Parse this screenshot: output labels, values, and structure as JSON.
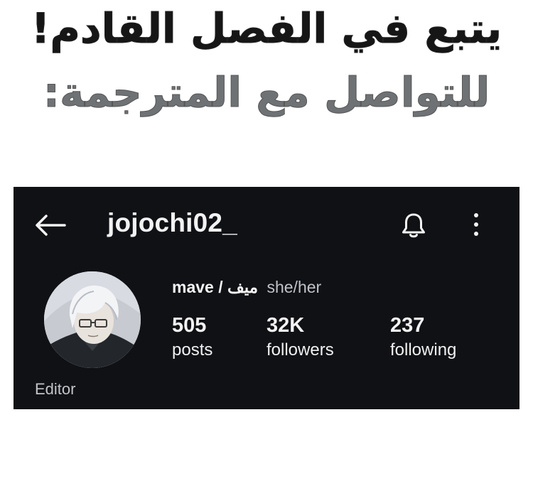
{
  "banner": {
    "line1": "يتبع في الفصل القادم!",
    "line2": "للتواصل مع المترجمة:"
  },
  "profile": {
    "username": "jojochi02_",
    "display_name": "mave / ميف",
    "pronouns": "she/her",
    "category": "Editor",
    "stats": {
      "posts": {
        "value": "505",
        "label": "posts"
      },
      "followers": {
        "value": "32K",
        "label": "followers"
      },
      "following": {
        "value": "237",
        "label": "following"
      }
    }
  },
  "icons": {
    "back": "back-arrow-icon",
    "notifications": "bell-icon",
    "more": "more-vertical-icon"
  },
  "colors": {
    "card_background": "#0f1115",
    "text_primary": "#f2f2f2",
    "text_secondary": "#c2c4c9"
  }
}
